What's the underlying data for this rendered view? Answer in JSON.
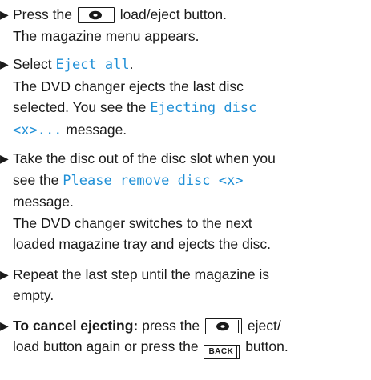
{
  "bullet_glyph": "▶",
  "steps": [
    {
      "a": "Press the",
      "b": "load/eject button.",
      "result": "The magazine menu appears."
    },
    {
      "a": "Select",
      "option": "Eject all",
      "end": ".",
      "r1": "The DVD changer ejects the last disc",
      "r2a": "selected. You see the",
      "msg1": "Ejecting disc",
      "msg2": "<x>...",
      "r3": "message."
    },
    {
      "l1": "Take the disc out of the disc slot when you",
      "l2a": "see the",
      "msg": "Please remove disc <x>",
      "l3": "message.",
      "r1": "The DVD changer switches to the next",
      "r2": "loaded magazine tray and ejects the disc."
    },
    {
      "l1": "Repeat the last step until the magazine is",
      "l2": "empty."
    },
    {
      "bold": "To cancel ejecting:",
      "a": "press the",
      "b": "eject/",
      "c": "load button again or press the",
      "back": "BACK",
      "d": "button."
    }
  ],
  "icons": {
    "eject_button": "disc-eject-button-icon",
    "back_button": "back-button-icon"
  },
  "colors": {
    "text": "#1a1a1a",
    "highlight": "#1f8fd6"
  }
}
